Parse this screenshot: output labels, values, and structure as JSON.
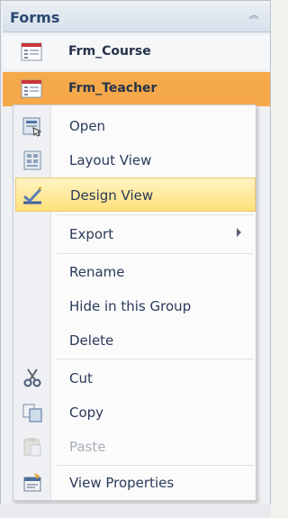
{
  "pane": {
    "title": "Forms",
    "collapse_glyph": "︽"
  },
  "objects": [
    {
      "label": "Frm_Course",
      "icon": "form-icon"
    },
    {
      "label": "Frm_Teacher",
      "icon": "form-icon",
      "selected": true
    }
  ],
  "context_menu": {
    "items": [
      {
        "label": "Open",
        "icon": "open-icon"
      },
      {
        "label": "Layout View",
        "icon": "layout-view-icon"
      },
      {
        "label": "Design View",
        "icon": "design-view-icon",
        "highlighted": true
      },
      {
        "label": "Export",
        "has_submenu": true
      },
      {
        "label": "Rename"
      },
      {
        "label": "Hide in this Group"
      },
      {
        "label": "Delete"
      },
      {
        "label": "Cut",
        "icon": "cut-icon"
      },
      {
        "label": "Copy",
        "icon": "copy-icon"
      },
      {
        "label": "Paste",
        "icon": "paste-icon",
        "disabled": true
      },
      {
        "label": "View Properties",
        "icon": "properties-icon"
      }
    ]
  },
  "colors": {
    "selected_row": "#f5a94a",
    "highlight": "#ffe07a",
    "title_text": "#2c4872"
  }
}
